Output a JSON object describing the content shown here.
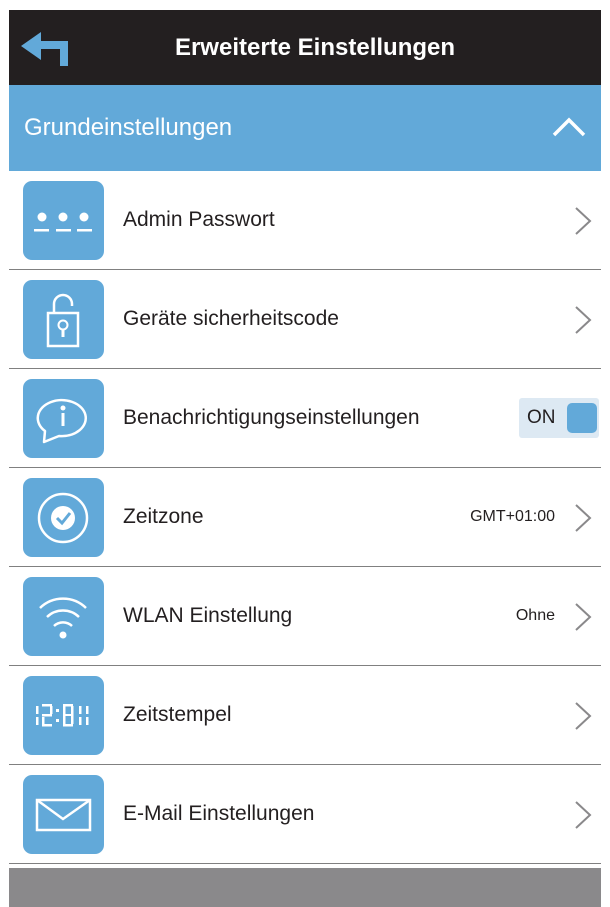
{
  "header": {
    "title": "Erweiterte Einstellungen",
    "back_icon": "back-arrow-icon"
  },
  "section": {
    "title": "Grundeinstellungen",
    "expanded": true,
    "collapse_icon": "chevron-up-icon"
  },
  "rows": [
    {
      "label": "Admin Passwort",
      "icon": "password-dots-icon"
    },
    {
      "label": "Geräte sicherheitscode",
      "icon": "padlock-icon"
    },
    {
      "label": "Benachrichtigungseinstellungen",
      "icon": "info-bubble-icon",
      "toggle": "ON"
    },
    {
      "label": "Zeitzone",
      "icon": "clock-check-icon",
      "value": "GMT+01:00"
    },
    {
      "label": "WLAN Einstellung",
      "icon": "wifi-icon",
      "value": "Ohne"
    },
    {
      "label": "Zeitstempel",
      "icon": "digital-clock-icon",
      "value": ""
    },
    {
      "label": "E-Mail Einstellungen",
      "icon": "envelope-icon"
    }
  ],
  "colors": {
    "header_bg": "#231f20",
    "accent": "#62a9d9",
    "footer_bg": "#8a898b"
  }
}
